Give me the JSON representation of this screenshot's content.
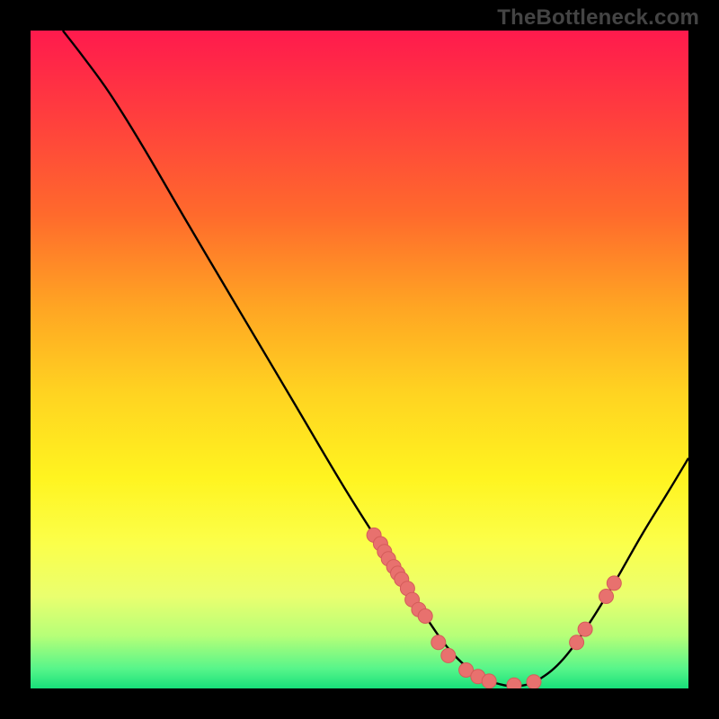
{
  "watermark": "TheBottleneck.com",
  "chart_data": {
    "type": "line",
    "title": "",
    "xlabel": "",
    "ylabel": "",
    "xlim": [
      0,
      100
    ],
    "ylim": [
      0,
      100
    ],
    "curve": [
      {
        "x": 4.9,
        "y": 100.0
      },
      {
        "x": 8.0,
        "y": 96.0
      },
      {
        "x": 12.0,
        "y": 90.5
      },
      {
        "x": 17.0,
        "y": 82.5
      },
      {
        "x": 24.0,
        "y": 70.5
      },
      {
        "x": 32.0,
        "y": 57.0
      },
      {
        "x": 40.0,
        "y": 43.5
      },
      {
        "x": 48.0,
        "y": 30.0
      },
      {
        "x": 55.0,
        "y": 19.0
      },
      {
        "x": 60.0,
        "y": 11.0
      },
      {
        "x": 64.0,
        "y": 5.5
      },
      {
        "x": 68.0,
        "y": 2.0
      },
      {
        "x": 71.5,
        "y": 0.6
      },
      {
        "x": 74.5,
        "y": 0.4
      },
      {
        "x": 77.5,
        "y": 1.5
      },
      {
        "x": 81.0,
        "y": 4.5
      },
      {
        "x": 85.0,
        "y": 10.0
      },
      {
        "x": 89.0,
        "y": 16.5
      },
      {
        "x": 93.0,
        "y": 23.5
      },
      {
        "x": 97.0,
        "y": 30.0
      },
      {
        "x": 100.0,
        "y": 35.0
      }
    ],
    "markers": [
      {
        "x": 52.2,
        "y": 23.3
      },
      {
        "x": 53.2,
        "y": 22.0
      },
      {
        "x": 53.8,
        "y": 20.8
      },
      {
        "x": 54.4,
        "y": 19.7
      },
      {
        "x": 55.2,
        "y": 18.5
      },
      {
        "x": 55.8,
        "y": 17.5
      },
      {
        "x": 56.4,
        "y": 16.6
      },
      {
        "x": 57.3,
        "y": 15.2
      },
      {
        "x": 58.0,
        "y": 13.5
      },
      {
        "x": 59.0,
        "y": 12.0
      },
      {
        "x": 60.0,
        "y": 11.0
      },
      {
        "x": 62.0,
        "y": 7.0
      },
      {
        "x": 63.5,
        "y": 5.0
      },
      {
        "x": 66.2,
        "y": 2.8
      },
      {
        "x": 68.0,
        "y": 1.8
      },
      {
        "x": 69.7,
        "y": 1.1
      },
      {
        "x": 73.5,
        "y": 0.5
      },
      {
        "x": 76.5,
        "y": 1.0
      },
      {
        "x": 83.0,
        "y": 7.0
      },
      {
        "x": 84.3,
        "y": 9.0
      },
      {
        "x": 87.5,
        "y": 14.0
      },
      {
        "x": 88.7,
        "y": 16.0
      }
    ],
    "colors": {
      "curve": "#000000",
      "marker_fill": "#e8716e",
      "marker_stroke": "#d45c59"
    }
  }
}
